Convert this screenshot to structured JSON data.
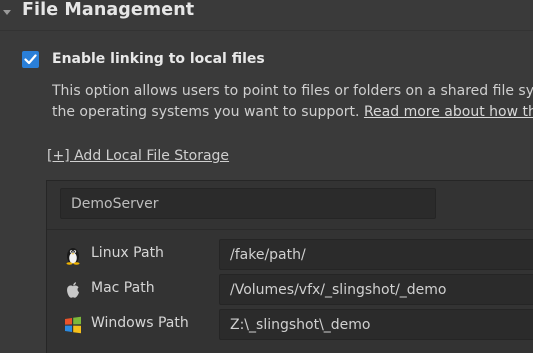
{
  "section": {
    "title": "File Management",
    "collapse_icon": "triangle-down-icon"
  },
  "linking": {
    "checked": true,
    "label": "Enable linking to local files",
    "description_line1": "This option allows users to point to files or folders on a shared file sy",
    "description_line2_prefix": "the operating systems you want to support. ",
    "read_more": "Read more about how th"
  },
  "add_storage": {
    "label": "[+] Add Local File Storage"
  },
  "storage": {
    "name": "DemoServer",
    "paths": [
      {
        "os": "linux",
        "icon": "tux-linux-icon",
        "label": "Linux Path",
        "value": "/fake/path/"
      },
      {
        "os": "mac",
        "icon": "apple-icon",
        "label": "Mac Path",
        "value": "/Volumes/vfx/_slingshot/_demo"
      },
      {
        "os": "windows",
        "icon": "windows-logo-icon",
        "label": "Windows Path",
        "value": "Z:\\_slingshot\\_demo"
      }
    ]
  },
  "colors": {
    "background": "#3a3a3a",
    "checkbox_accent": "#2a7fd8",
    "panel": "#333333",
    "input": "#2b2b2b"
  }
}
